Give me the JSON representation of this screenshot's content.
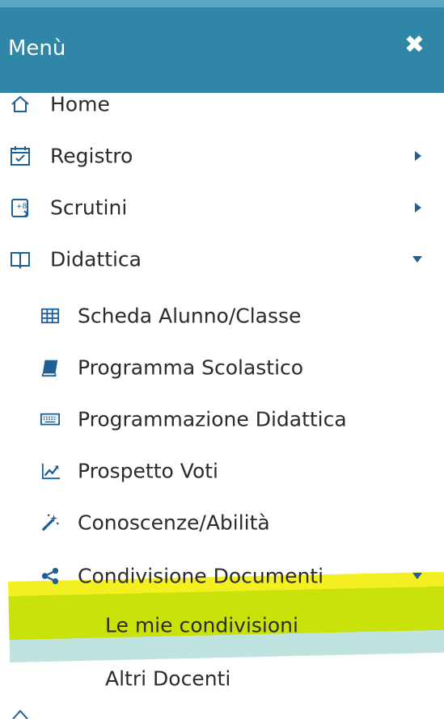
{
  "menu": {
    "title": "Menù",
    "close_icon": "close-icon"
  },
  "items": [
    {
      "label": "Home",
      "icon": "home-icon"
    },
    {
      "label": "Registro",
      "icon": "calendar-icon",
      "arrow": "caret-right"
    },
    {
      "label": "Scrutini",
      "icon": "scrutini-icon",
      "arrow": "caret-right"
    },
    {
      "label": "Didattica",
      "icon": "book-open-icon",
      "arrow": "caret-down"
    },
    {
      "label": "Scheda Alunno/Classe",
      "icon": "table-icon"
    },
    {
      "label": "Programma Scolastico",
      "icon": "book-icon"
    },
    {
      "label": "Programmazione Didattica",
      "icon": "keyboard-icon"
    },
    {
      "label": "Prospetto Voti",
      "icon": "line-chart-icon"
    },
    {
      "label": "Conoscenze/Abilità",
      "icon": "magic-wand-icon"
    },
    {
      "label": "Condivisione Documenti",
      "icon": "share-icon",
      "arrow": "caret-down"
    },
    {
      "label": "Le mie condivisioni",
      "highlight_colors": [
        "#f4ef20",
        "#c9e30a",
        "#bfe3df"
      ]
    },
    {
      "label": "Altri Docenti"
    }
  ],
  "colors": {
    "header_bg": "#2f86a6",
    "header_top_strip": "#5ba8c6",
    "icon_blue": "#1f5f93",
    "text": "#2b2b2b"
  }
}
